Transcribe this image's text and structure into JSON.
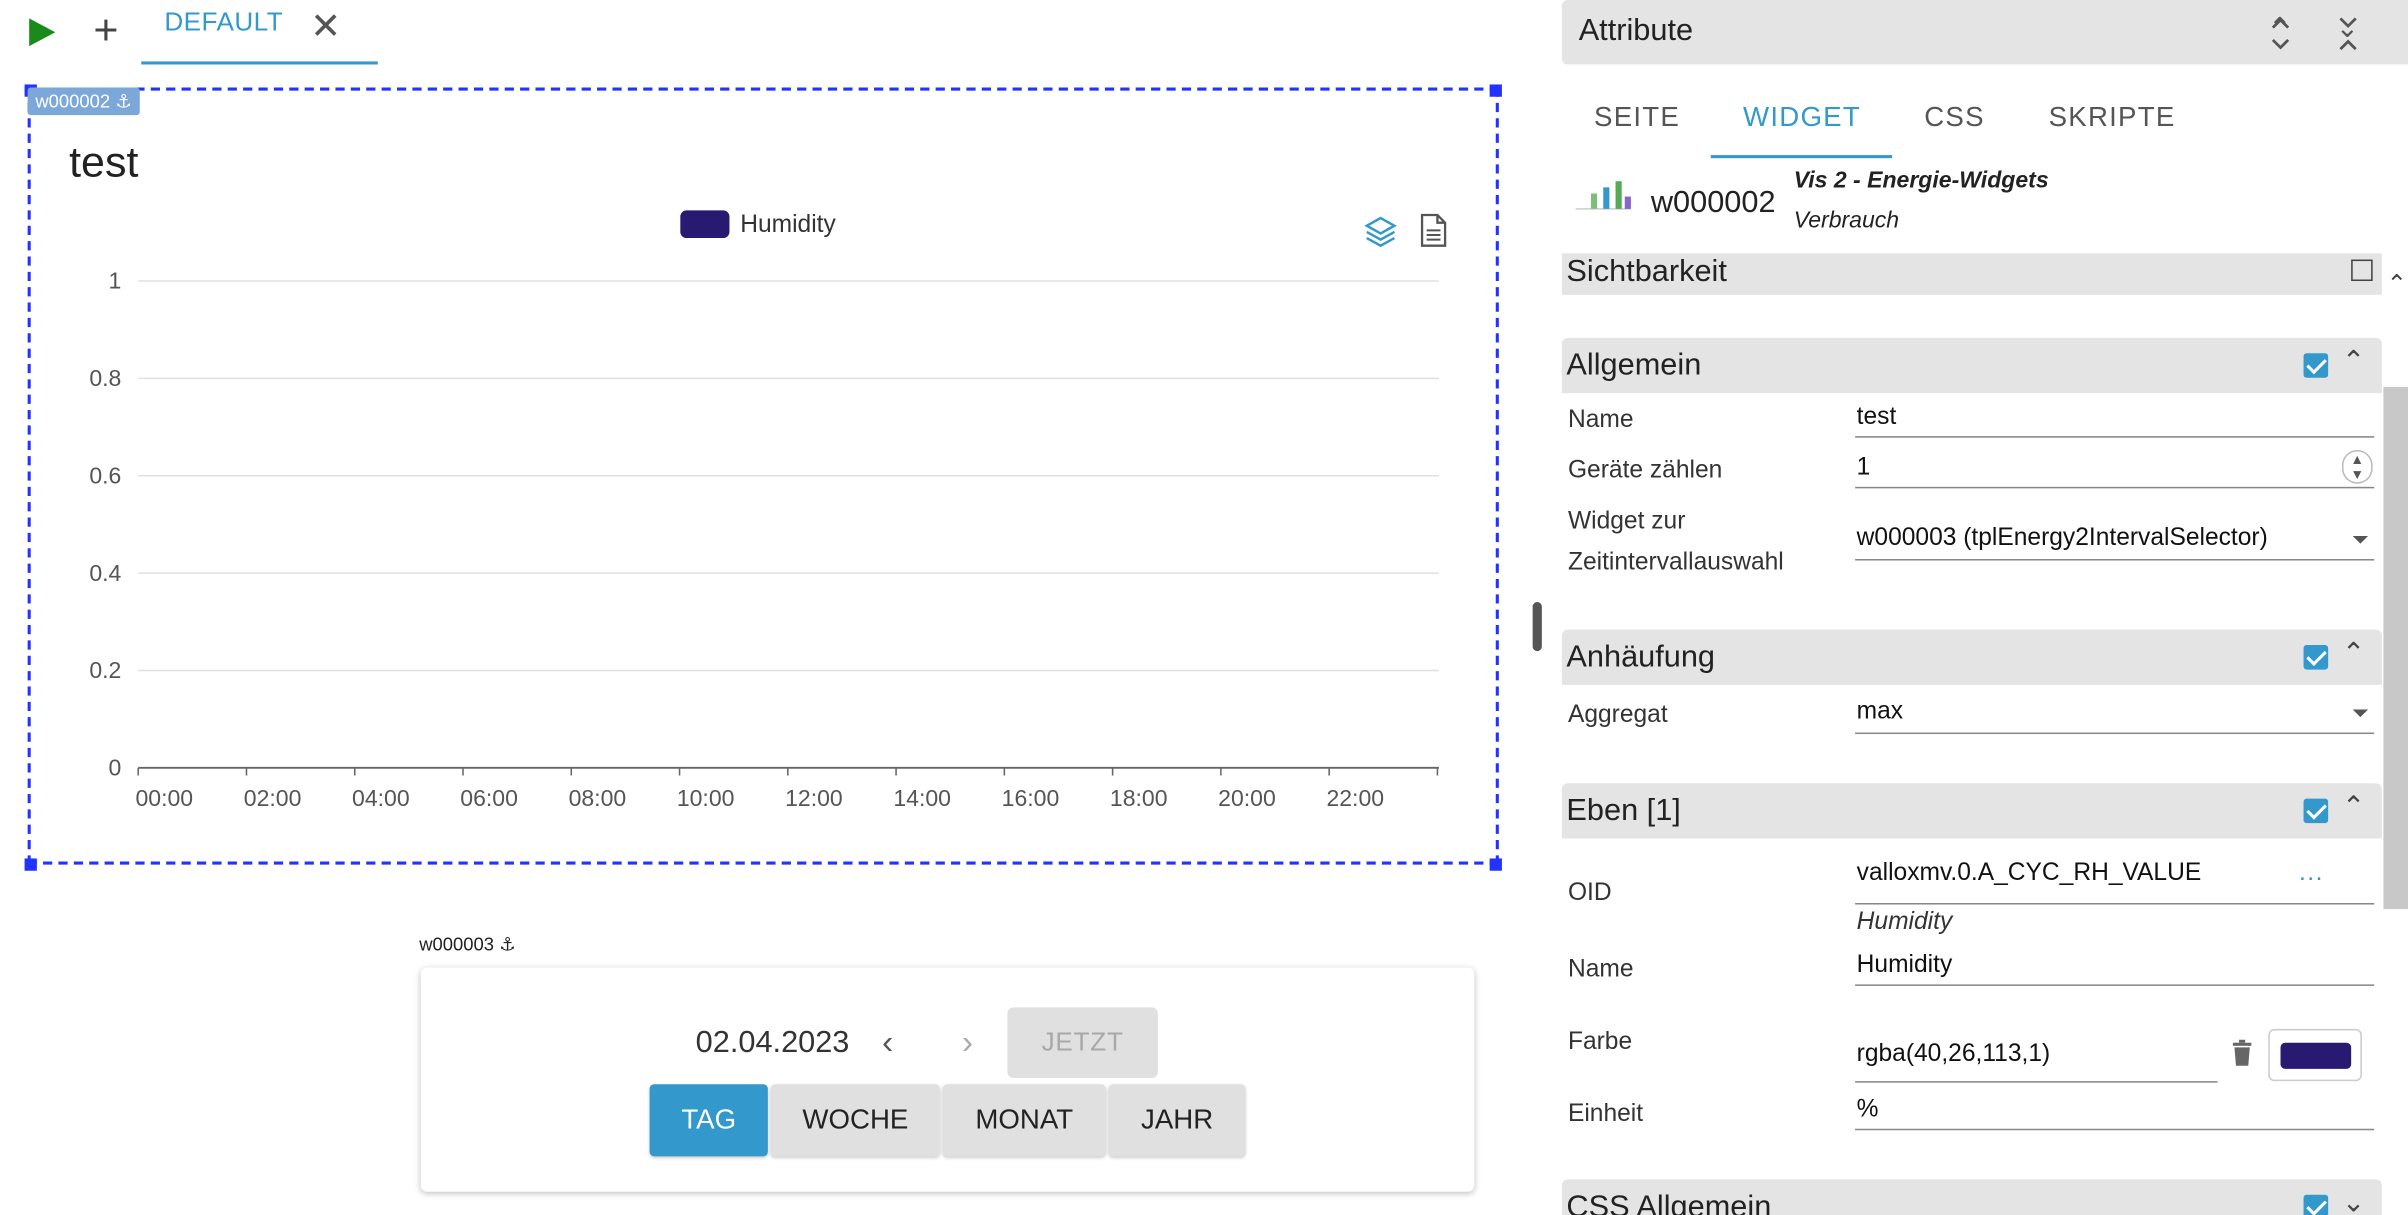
{
  "toolbar": {
    "tab_label": "DEFAULT"
  },
  "widget_main": {
    "tag": "w000002 ⚓",
    "title": "test"
  },
  "chart_data": {
    "type": "line",
    "title": "test",
    "series": [
      {
        "name": "Humidity",
        "color": "#281a71",
        "values": []
      }
    ],
    "x": [
      "00:00",
      "02:00",
      "04:00",
      "06:00",
      "08:00",
      "10:00",
      "12:00",
      "14:00",
      "16:00",
      "18:00",
      "20:00",
      "22:00"
    ],
    "ylim": [
      0,
      1
    ],
    "yticks": [
      "0",
      "0.2",
      "0.4",
      "0.6",
      "0.8",
      "1"
    ],
    "grid": true,
    "legend": "top-center"
  },
  "widget_interval": {
    "tag": "w000003 ⚓",
    "date": "02.04.2023",
    "now_label": "JETZT",
    "segments": [
      "TAG",
      "WOCHE",
      "MONAT",
      "JAHR"
    ],
    "active_segment": "TAG"
  },
  "panel": {
    "title": "Attribute",
    "tabs": [
      "SEITE",
      "WIDGET",
      "CSS",
      "SKRIPTE"
    ],
    "active_tab": "WIDGET",
    "widget_id": "w000002",
    "widget_set": "Vis 2 - Energie-Widgets",
    "widget_type": "Verbrauch",
    "sections": {
      "visibility": "Sichtbarkeit",
      "general": {
        "title": "Allgemein",
        "name_label": "Name",
        "name_value": "test",
        "count_label": "Geräte zählen",
        "count_value": "1",
        "interval_label_1": "Widget zur",
        "interval_label_2": "Zeitintervallauswahl",
        "interval_value": "w000003 (tplEnergy2IntervalSelector)"
      },
      "aggregation": {
        "title": "Anhäufung",
        "agg_label": "Aggregat",
        "agg_value": "max"
      },
      "layers": {
        "title": "Eben [1]",
        "oid_label": "OID",
        "oid_value": "valloxmv.0.A_CYC_RH_VALUE",
        "oid_sub": "Humidity",
        "oid_more": "...",
        "name_label": "Name",
        "name_value": "Humidity",
        "color_label": "Farbe",
        "color_value": "rgba(40,26,113,1)",
        "color_swatch": "#281a71",
        "unit_label": "Einheit",
        "unit_value": "%"
      },
      "css_general": "CSS Allgemein"
    }
  },
  "colors": {
    "accent": "#3399cc",
    "selection": "#2233ff",
    "series": "#281a71"
  }
}
